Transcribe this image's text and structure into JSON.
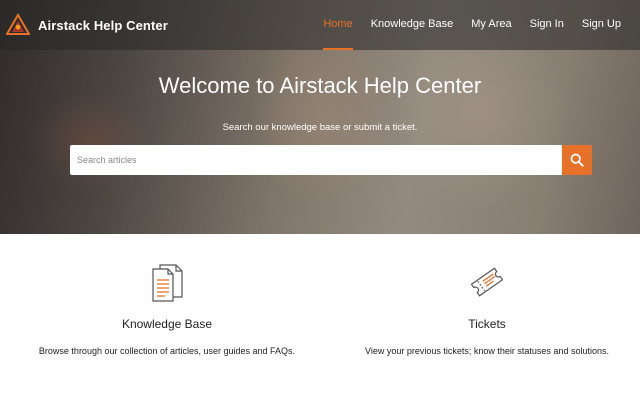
{
  "brand": {
    "name": "Airstack Help Center",
    "logo_icon": "airstack-logo-icon",
    "accent_color": "#e8712a"
  },
  "nav": {
    "items": [
      {
        "label": "Home",
        "active": true
      },
      {
        "label": "Knowledge Base",
        "active": false
      },
      {
        "label": "My Area",
        "active": false
      },
      {
        "label": "Sign In",
        "active": false
      },
      {
        "label": "Sign Up",
        "active": false
      }
    ]
  },
  "hero": {
    "title": "Welcome to Airstack Help Center",
    "subtitle": "Search our knowledge base or submit a ticket.",
    "search": {
      "placeholder": "Search articles",
      "value": "",
      "button_icon": "search-icon"
    }
  },
  "cards": [
    {
      "icon": "document-icon",
      "title": "Knowledge Base",
      "description": "Browse through our collection of articles, user guides and FAQs."
    },
    {
      "icon": "ticket-icon",
      "title": "Tickets",
      "description": "View your previous tickets; know their statuses and solutions."
    }
  ]
}
